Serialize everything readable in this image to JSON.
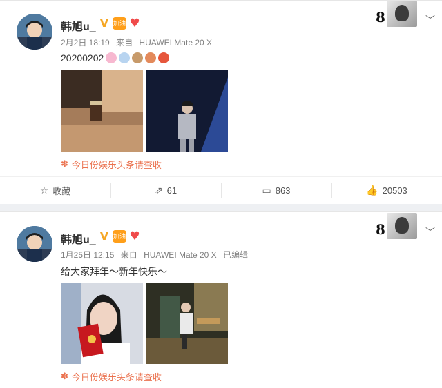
{
  "posts": [
    {
      "username": "韩旭u_",
      "level_badge": "加油",
      "date": "2月2日 18:19",
      "source_prefix": "来自",
      "device": "HUAWEI Mate 20 X",
      "edited": "",
      "text": "20200202",
      "emoji_count": 5,
      "images": [
        {
          "desc": "bottle-on-table-photo",
          "colors": [
            "#c9a07a",
            "#3b2a1e"
          ]
        },
        {
          "desc": "stage-performer-photo",
          "colors": [
            "#1a2440",
            "#6a7ea8"
          ]
        }
      ],
      "source_link": "今日份娱乐头条请查收",
      "actions": {
        "favorite": "收藏",
        "repost": "61",
        "comment": "863",
        "like": "20503"
      }
    },
    {
      "username": "韩旭u_",
      "level_badge": "加油",
      "date": "1月25日 12:15",
      "source_prefix": "来自",
      "device": "HUAWEI Mate 20 X",
      "edited": "已编辑",
      "text": "给大家拜年～新年快乐～",
      "images": [
        {
          "desc": "selfie-red-envelope-photo",
          "colors": [
            "#d8dde6",
            "#c7181f"
          ]
        },
        {
          "desc": "stage-seated-photo",
          "colors": [
            "#3a3a2a",
            "#b9a77c"
          ]
        }
      ],
      "source_link": "今日份娱乐头条请查收"
    }
  ],
  "colors": {
    "accent": "#eb7350",
    "vip": "#f5a623",
    "heart": "#f04a4a"
  }
}
